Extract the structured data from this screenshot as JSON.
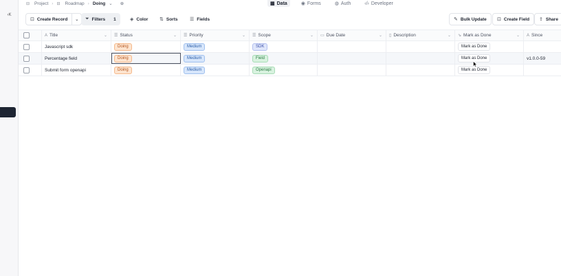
{
  "left_strip": {
    "shortcut": "K"
  },
  "breadcrumb": {
    "items": [
      "Project",
      "Roadmap",
      "Doing"
    ],
    "icons": [
      "project-icon",
      "table-icon"
    ],
    "add": "⊕"
  },
  "tabs": [
    {
      "label": "Data",
      "icon": "grid-icon",
      "active": true
    },
    {
      "label": "Forms",
      "icon": "eye-icon",
      "active": false
    },
    {
      "label": "Auth",
      "icon": "globe-icon",
      "active": false
    },
    {
      "label": "Developer",
      "icon": "code-icon",
      "active": false
    }
  ],
  "toolbar": {
    "create_record": "Create Record",
    "filters": "Filters",
    "filters_count": "1",
    "color": "Color",
    "sorts": "Sorts",
    "fields": "Fields",
    "bulk_update": "Bulk Update",
    "create_field": "Create Field",
    "share": "Share"
  },
  "columns": [
    {
      "label": "Title",
      "icon": "A"
    },
    {
      "label": "Status",
      "icon": "☰"
    },
    {
      "label": "Priority",
      "icon": "☰"
    },
    {
      "label": "Scope",
      "icon": "☰"
    },
    {
      "label": "Due Date",
      "icon": "▭"
    },
    {
      "label": "Description",
      "icon": "▯"
    },
    {
      "label": "Mark as Done",
      "icon": "⇘"
    },
    {
      "label": "Since",
      "icon": "A"
    }
  ],
  "rows": [
    {
      "title": "Javascript sdk",
      "status": "Doing",
      "priority": "Medium",
      "scope": "SDK",
      "due_date": "",
      "description": "",
      "mark_as_done": "Mark as Done",
      "since": ""
    },
    {
      "title": "Percentage field",
      "status": "Doing",
      "priority": "Medium",
      "scope": "Field",
      "due_date": "",
      "description": "",
      "mark_as_done": "Mark as Done",
      "since": "v1.0.0-59"
    },
    {
      "title": "Submit form openapi",
      "status": "Doing",
      "priority": "Medium",
      "scope": "Openapi",
      "due_date": "",
      "description": "",
      "mark_as_done": "Mark as Done",
      "since": ""
    }
  ],
  "colors": {
    "doing": "#fde4cf",
    "medium": "#d7e6fb",
    "sdk": "#dfe6fb",
    "field": "#d8f2df",
    "openapi": "#d8f2df"
  }
}
